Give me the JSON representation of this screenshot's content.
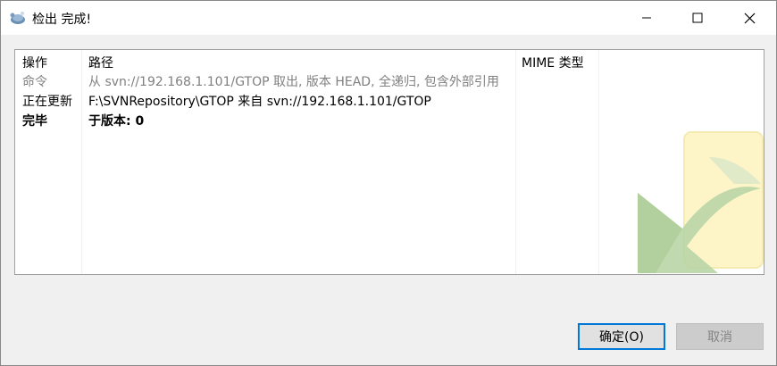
{
  "window": {
    "title": "检出 完成!",
    "icon": "tortoise-svn-icon"
  },
  "columns": [
    {
      "label": "操作"
    },
    {
      "label": "路径"
    },
    {
      "label": "MIME 类型"
    }
  ],
  "rows": [
    {
      "action": "命令",
      "path": "从 svn://192.168.1.101/GTOP 取出, 版本 HEAD, 全递归, 包含外部引用",
      "style": "gray"
    },
    {
      "action": "正在更新",
      "path": "F:\\SVNRepository\\GTOP 来自 svn://192.168.1.101/GTOP",
      "style": "normal"
    },
    {
      "action": "完毕",
      "path": "于版本: 0",
      "style": "bold"
    }
  ],
  "buttons": {
    "ok_label": "确定(O)",
    "cancel_label": "取消"
  },
  "colors": {
    "accent": "#0078d7",
    "watermark_green": "#b9d5a6",
    "watermark_yellow": "#fdf5c8"
  }
}
